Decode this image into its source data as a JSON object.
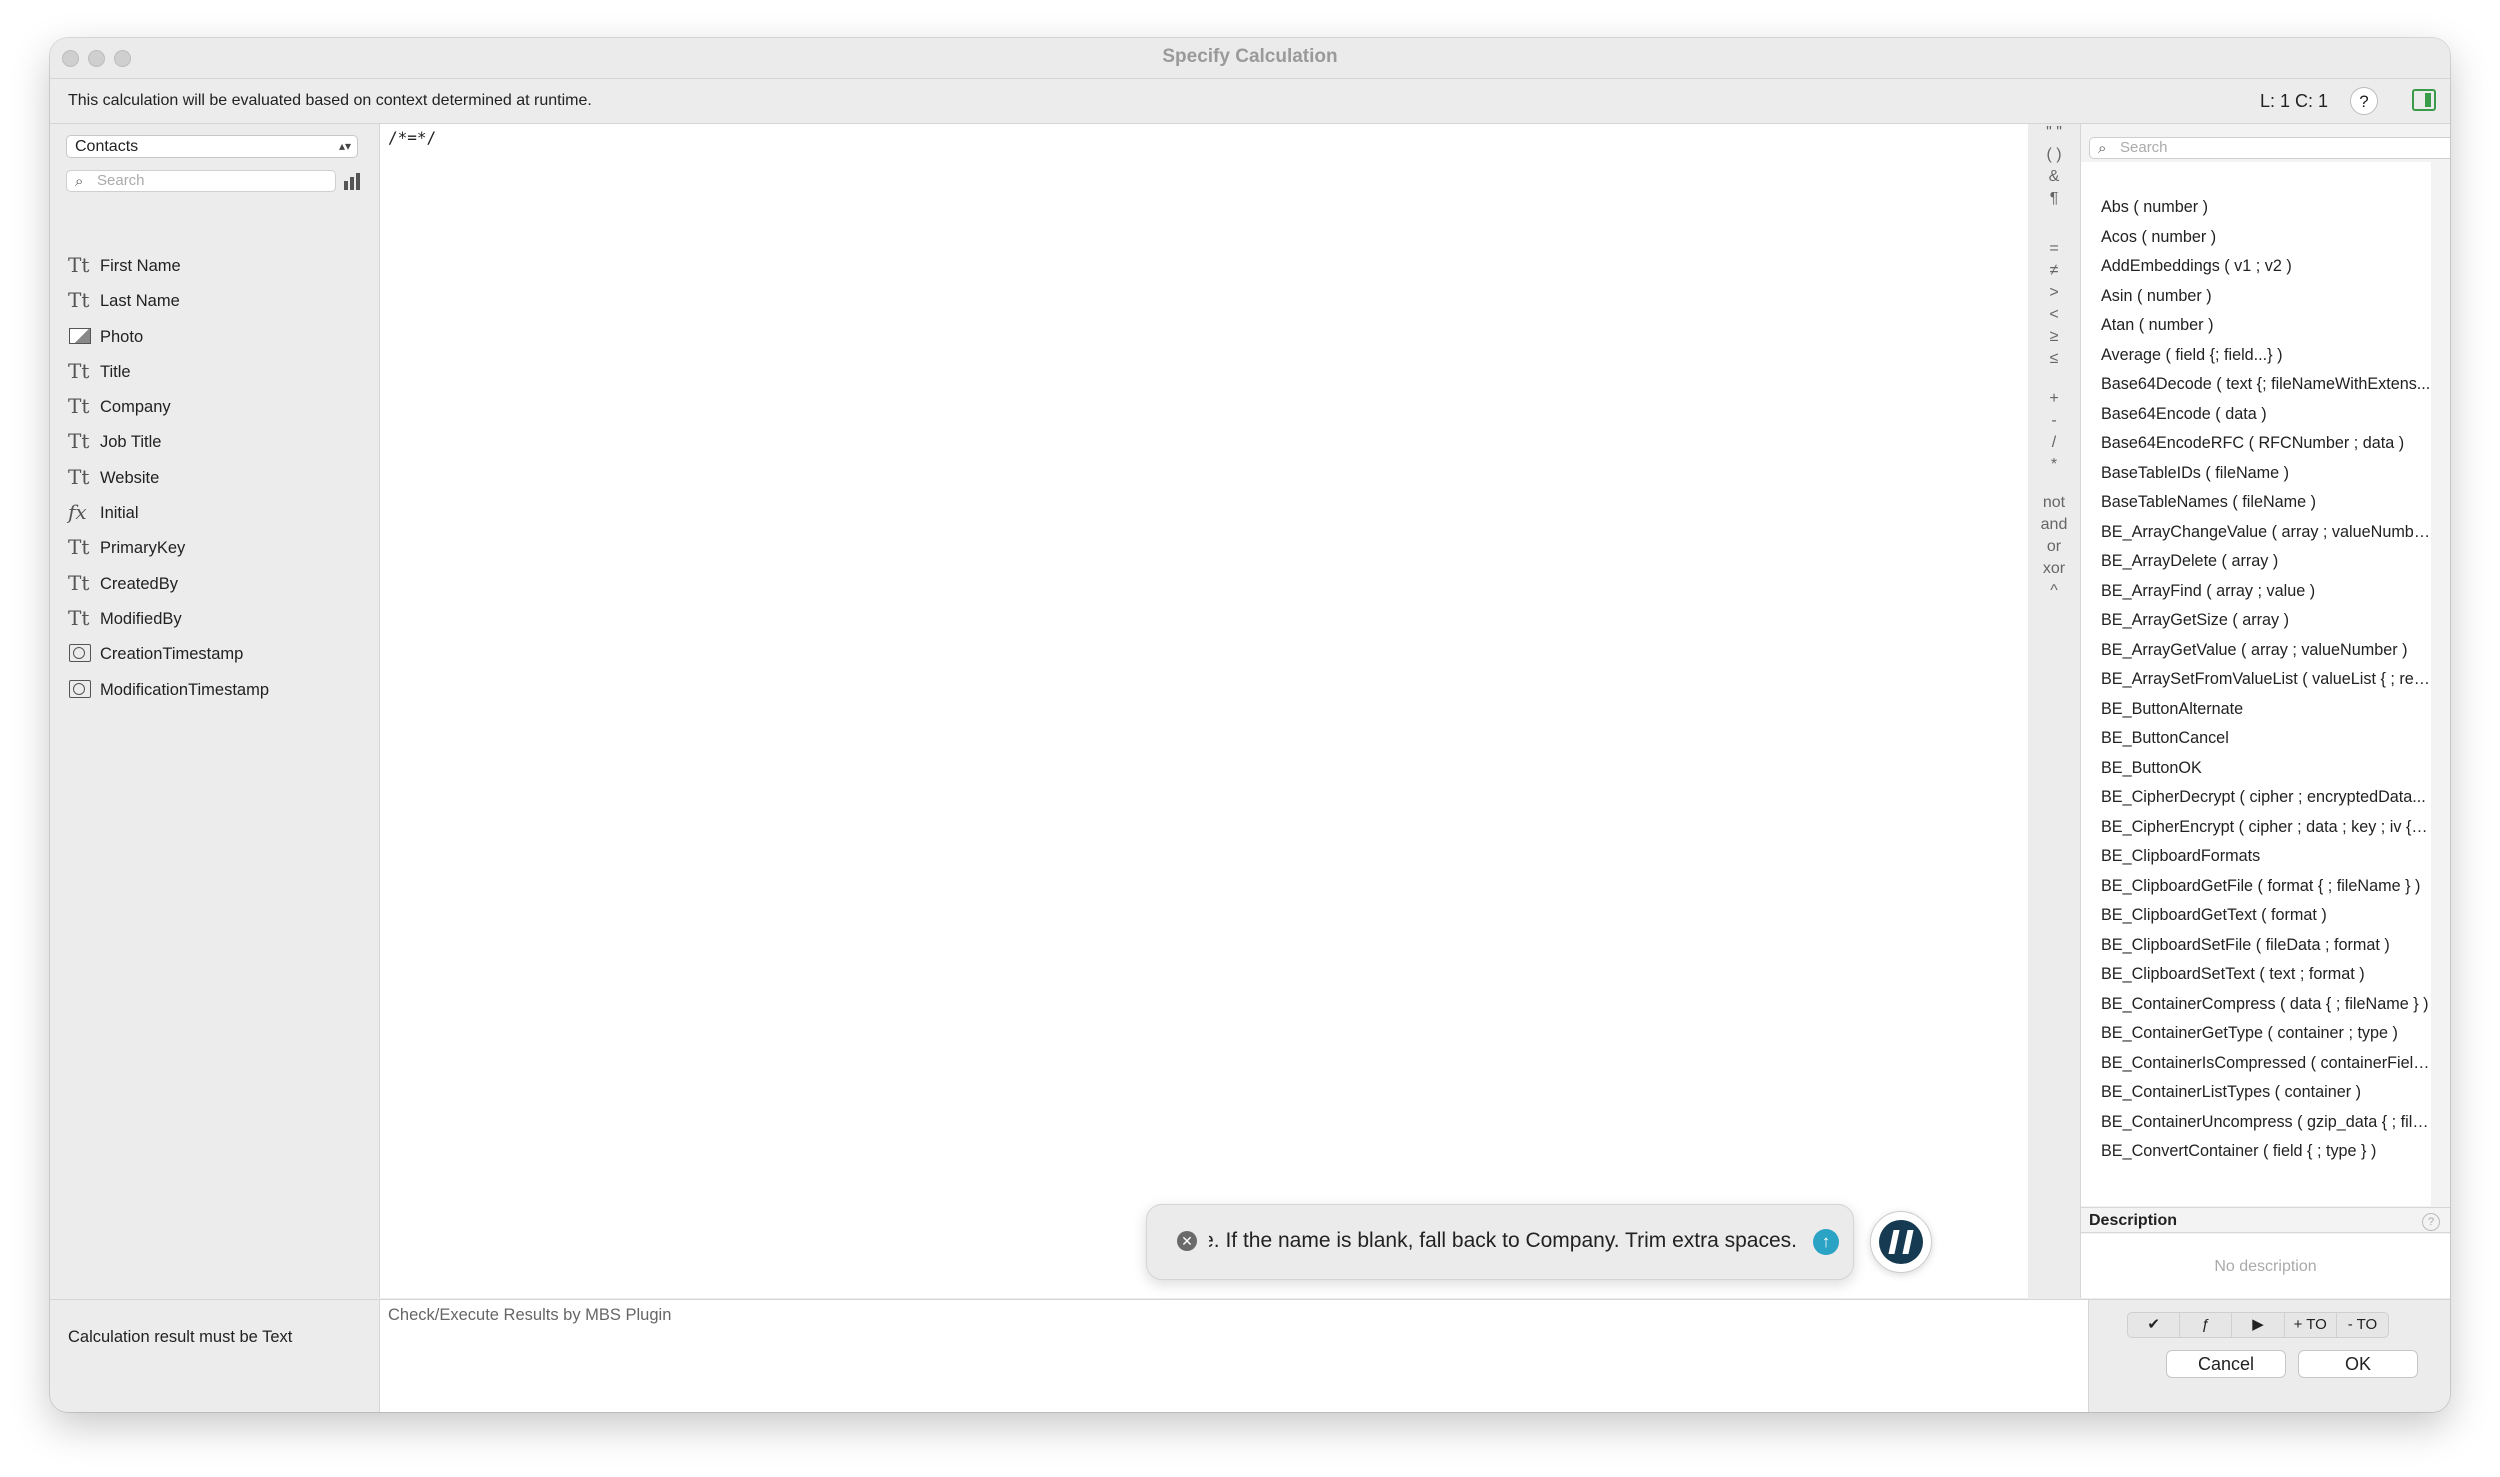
{
  "window": {
    "title": "Specify Calculation"
  },
  "info": {
    "context_text": "This calculation will be evaluated based on context determined at runtime.",
    "cursor_position": "L: 1 C: 1",
    "help_label": "?"
  },
  "left_panel": {
    "table_select": "Contacts",
    "search_placeholder": "Search",
    "fields": [
      {
        "name": "First Name",
        "icon": "text-field-icon"
      },
      {
        "name": "Last Name",
        "icon": "text-field-icon"
      },
      {
        "name": "Photo",
        "icon": "container-field-icon"
      },
      {
        "name": "Title",
        "icon": "text-field-icon"
      },
      {
        "name": "Company",
        "icon": "text-field-icon"
      },
      {
        "name": "Job Title",
        "icon": "text-field-icon"
      },
      {
        "name": "Website",
        "icon": "text-field-icon"
      },
      {
        "name": "Initial",
        "icon": "calculation-field-icon"
      },
      {
        "name": "PrimaryKey",
        "icon": "text-field-icon"
      },
      {
        "name": "CreatedBy",
        "icon": "text-field-icon"
      },
      {
        "name": "ModifiedBy",
        "icon": "text-field-icon"
      },
      {
        "name": "CreationTimestamp",
        "icon": "timestamp-field-icon"
      },
      {
        "name": "ModificationTimestamp",
        "icon": "timestamp-field-icon"
      }
    ],
    "text_icon_glyph": "Tt",
    "calc_icon_glyph": "fx"
  },
  "editor": {
    "code": "/*=*/"
  },
  "operators": {
    "items": [
      "\" \"",
      "( )",
      "&",
      "¶",
      "=",
      "≠",
      ">",
      "<",
      "≥",
      "≤",
      "+",
      "-",
      "/",
      "*",
      "not",
      "and",
      "or",
      "xor",
      "^"
    ]
  },
  "right_panel": {
    "search_placeholder": "Search",
    "functions": [
      "Abs ( number )",
      "Acos ( number )",
      "AddEmbeddings ( v1 ; v2 )",
      "Asin ( number )",
      "Atan ( number )",
      "Average ( field {; field...} )",
      "Base64Decode ( text {; fileNameWithExtens...",
      "Base64Encode ( data )",
      "Base64EncodeRFC ( RFCNumber ; data )",
      "BaseTableIDs ( fileName )",
      "BaseTableNames ( fileName )",
      "BE_ArrayChangeValue ( array ; valueNumbe...",
      "BE_ArrayDelete ( array )",
      "BE_ArrayFind ( array ; value )",
      "BE_ArrayGetSize ( array )",
      "BE_ArrayGetValue ( array ; valueNumber )",
      "BE_ArraySetFromValueList ( valueList { ; ret...",
      "BE_ButtonAlternate",
      "BE_ButtonCancel",
      "BE_ButtonOK",
      "BE_CipherDecrypt ( cipher ; encryptedData...",
      "BE_CipherEncrypt ( cipher ; data ; key ; iv { ;...",
      "BE_ClipboardFormats",
      "BE_ClipboardGetFile ( format { ; fileName } )",
      "BE_ClipboardGetText ( format )",
      "BE_ClipboardSetFile ( fileData ; format )",
      "BE_ClipboardSetText ( text ; format )",
      "BE_ContainerCompress ( data { ; fileName } )",
      "BE_ContainerGetType ( container ; type )",
      "BE_ContainerIsCompressed ( containerField )",
      "BE_ContainerListTypes ( container )",
      "BE_ContainerUncompress ( gzip_data { ; file...",
      "BE_ConvertContainer ( field { ; type } )"
    ],
    "description_title": "Description",
    "description_text": "No description"
  },
  "bottom": {
    "result_label": "Calculation result must be  Text",
    "results_label": "Check/Execute Results by MBS Plugin",
    "segments": [
      "✔",
      "ƒ",
      "▶",
      "+ TO",
      "- TO"
    ],
    "cancel_label": "Cancel",
    "ok_label": "OK"
  },
  "assistant": {
    "prompt_text": "able. If the name is blank, fall back to Company. Trim extra spaces.",
    "clear_glyph": "✕",
    "send_glyph": "↑",
    "send_color": "#2aa3c4"
  }
}
